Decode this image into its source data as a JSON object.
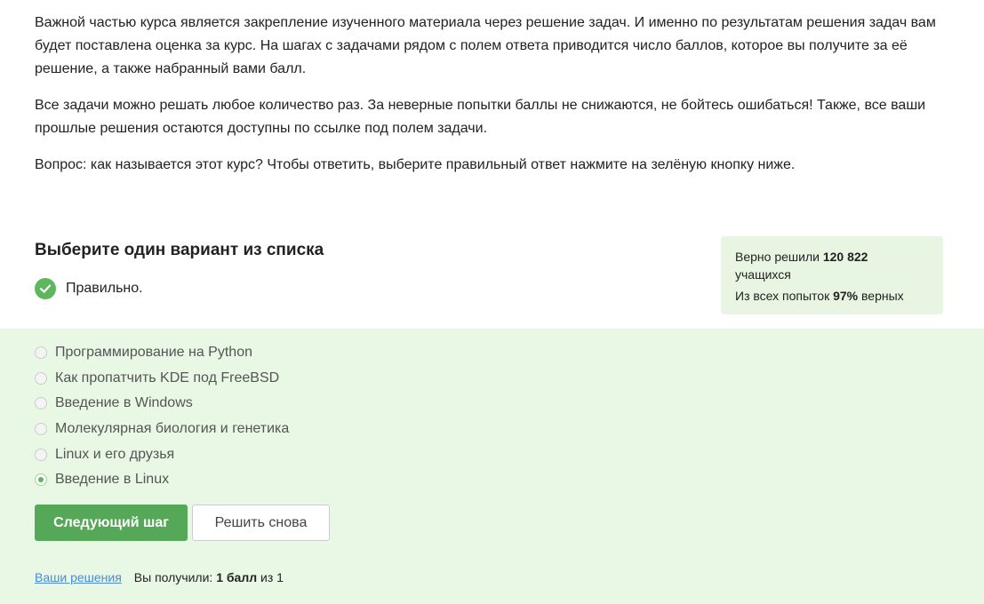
{
  "intro": {
    "paragraph1": "Важной частью курса является закрепление изученного материала через решение задач. И именно по результатам решения задач вам будет поставлена оценка за курс. На шагах с задачами рядом с полем ответа приводится число баллов, которое вы получите за её решение, а также набранный вами балл.",
    "paragraph2": "Все задачи можно решать любое количество раз. За неверные попытки баллы не снижаются, не бойтесь ошибаться! Также, все ваши прошлые решения остаются доступны по ссылке под полем задачи.",
    "paragraph3": "Вопрос: как называется этот курс? Чтобы ответить, выберите правильный ответ нажмите на зелёную кнопку ниже."
  },
  "quiz": {
    "title": "Выберите один вариант из списка",
    "result_text": "Правильно.",
    "options": [
      {
        "label": "Программирование на Python",
        "selected": false
      },
      {
        "label": "Как пропатчить KDE под FreeBSD",
        "selected": false
      },
      {
        "label": "Введение в Windows",
        "selected": false
      },
      {
        "label": "Молекулярная биология и генетика",
        "selected": false
      },
      {
        "label": "Linux и его друзья",
        "selected": false
      },
      {
        "label": "Введение в Linux",
        "selected": true
      }
    ]
  },
  "stats": {
    "solved_prefix": "Верно решили",
    "solved_count": "120 822",
    "solved_suffix": "учащихся",
    "attempts_prefix": "Из всех попыток",
    "attempts_percent": "97%",
    "attempts_suffix": "верных"
  },
  "buttons": {
    "next_label": "Следующий шаг",
    "retry_label": "Решить снова"
  },
  "footer": {
    "solutions_link": "Ваши решения",
    "score_prefix": "Вы получили:",
    "score_value": "1 балл",
    "score_suffix": "из 1"
  },
  "colors": {
    "accent_green": "#54a858",
    "panel_green": "#e9f7e5",
    "link_blue": "#4a8bd4"
  }
}
